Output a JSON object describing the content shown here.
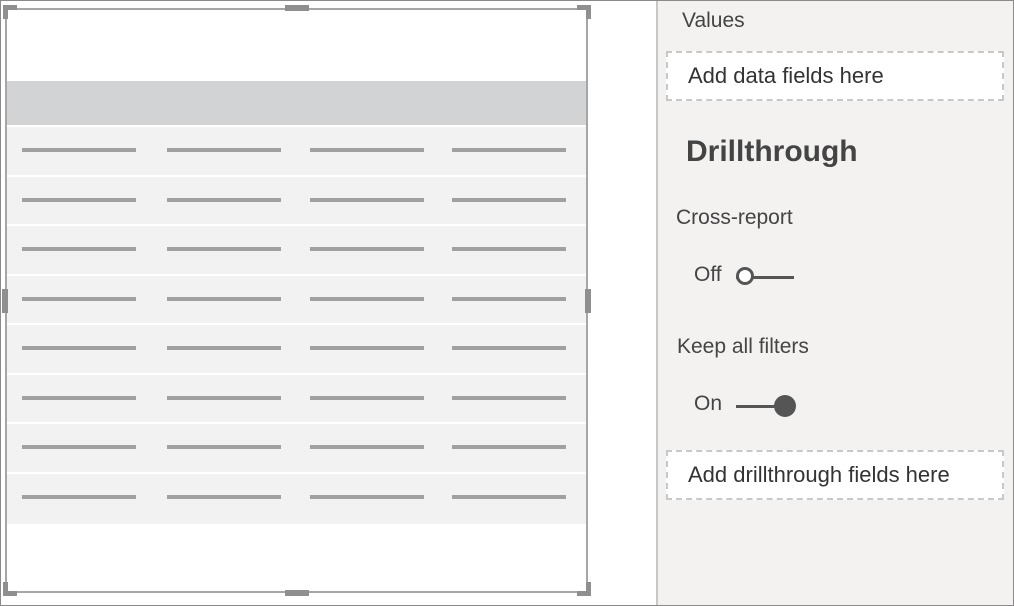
{
  "colors": {
    "pane_background": "#f3f2f1",
    "table_header": "#d2d3d4",
    "table_row": "#f2f2f2",
    "placeholder_line": "#a0a0a0",
    "toggle": "#555555"
  },
  "canvas": {
    "table_visual": {
      "row_count": 8,
      "column_count": 4
    }
  },
  "pane": {
    "values_label": "Values",
    "values_well": "Add data fields here",
    "drillthrough_title": "Drillthrough",
    "cross_report": {
      "label": "Cross-report",
      "state_text": "Off",
      "state": false
    },
    "keep_all_filters": {
      "label": "Keep all filters",
      "state_text": "On",
      "state": true
    },
    "drillthrough_well": "Add drillthrough fields here"
  }
}
